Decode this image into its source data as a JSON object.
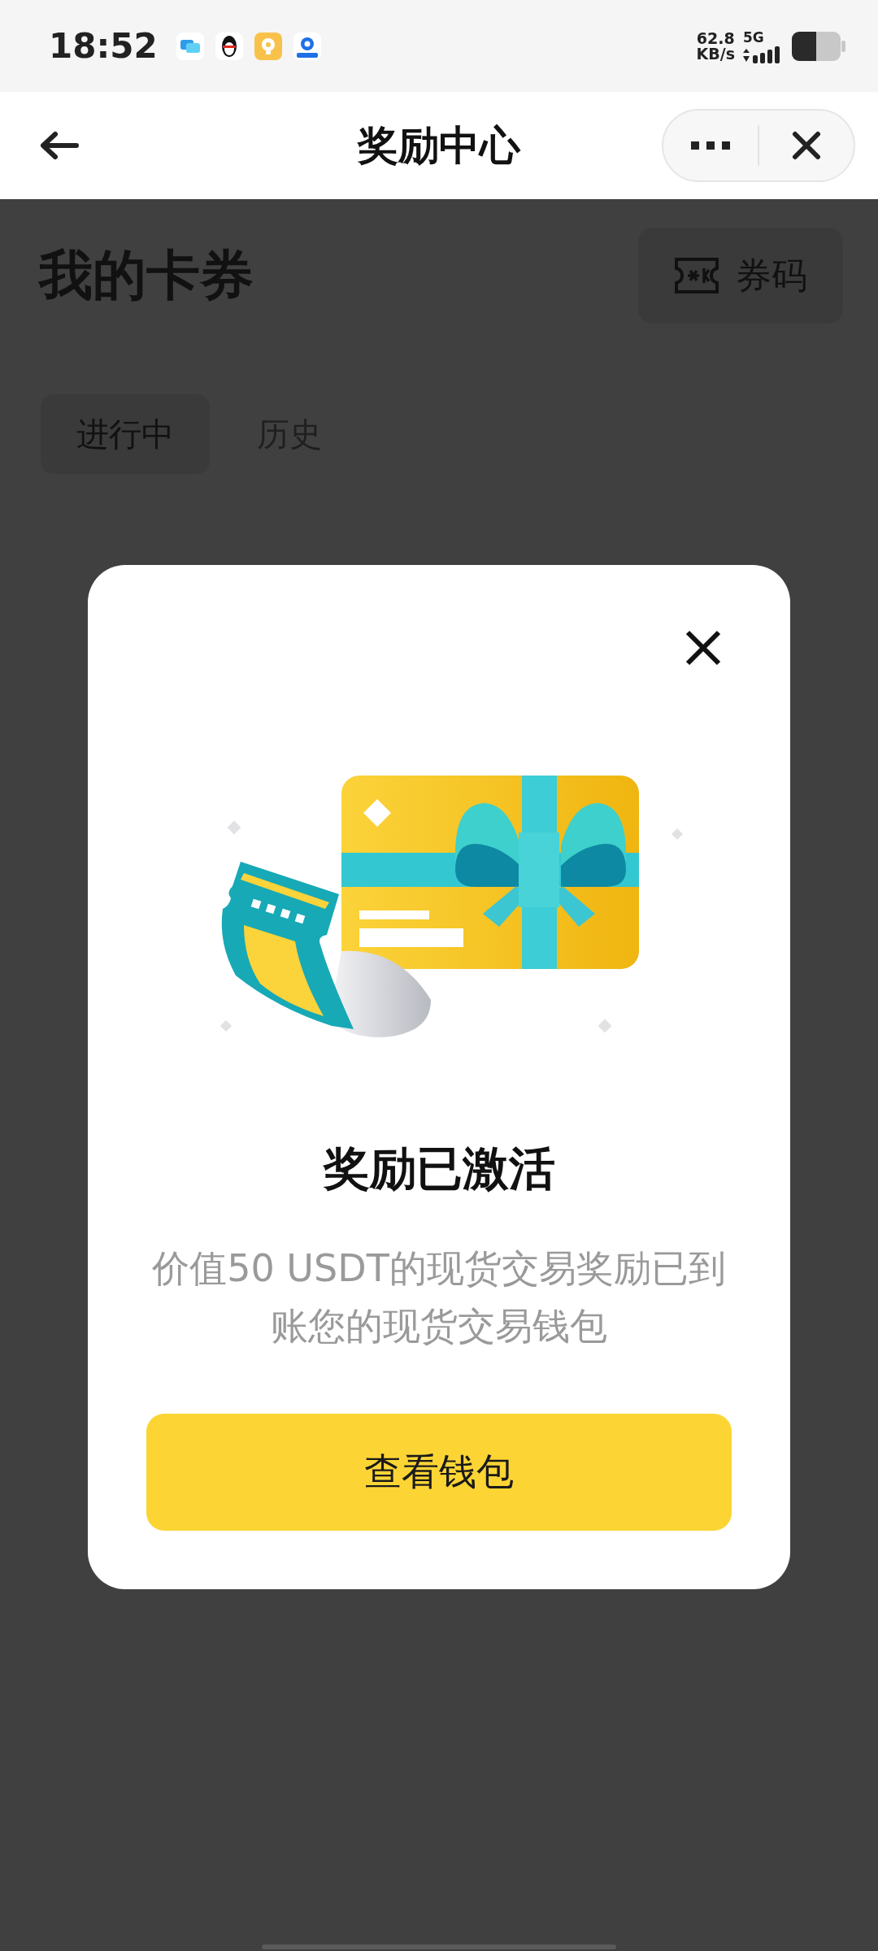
{
  "status_bar": {
    "time": "18:52",
    "network_speed": "62.8",
    "speed_unit": "KB/s",
    "network_type": "5G"
  },
  "nav": {
    "title": "奖励中心"
  },
  "page": {
    "title": "我的卡券",
    "code_button": "券码",
    "tabs": [
      {
        "label": "进行中",
        "selected": true
      },
      {
        "label": "历史",
        "selected": false
      }
    ]
  },
  "dialog": {
    "title": "奖励已激活",
    "description": "价值50 USDT的现货交易奖励已到账您的现货交易钱包",
    "button": "查看钱包"
  }
}
